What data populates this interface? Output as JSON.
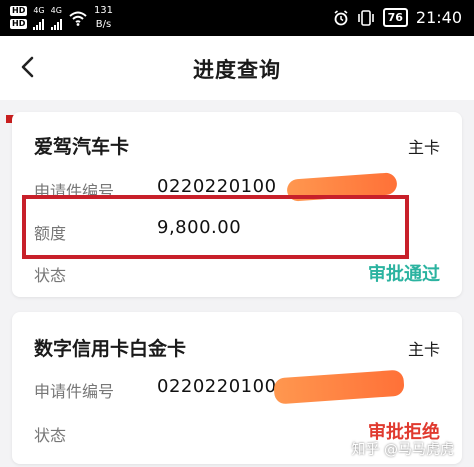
{
  "status_bar": {
    "hd_top": "HD",
    "hd_bottom": "HD",
    "network_top": "4G",
    "network_bottom": "4G",
    "speed_value": "131",
    "speed_unit": "B/s",
    "battery": "76",
    "time": "21:40",
    "icons": [
      "alarm-icon",
      "vibrate-icon",
      "wifi-icon",
      "signal-icon"
    ]
  },
  "header": {
    "title": "进度查询",
    "back_icon": "chevron-left-icon"
  },
  "cards": [
    {
      "title": "爱驾汽车卡",
      "tag": "主卡",
      "app_no_label": "申请件编号",
      "app_no_value": "0220220100",
      "limit_label": "额度",
      "limit_value": "9,800.00",
      "status_label": "状态",
      "status_value": "审批通过"
    },
    {
      "title": "数字信用卡白金卡",
      "tag": "主卡",
      "app_no_label": "申请件编号",
      "app_no_value": "0220220100",
      "status_label": "状态",
      "status_value": "审批拒绝"
    }
  ],
  "watermark": "知乎 @马马虎虎",
  "colors": {
    "approved": "#2bb3a0",
    "rejected": "#e03a2f",
    "highlight": "#c8202a",
    "redaction": "#ff7a3c"
  }
}
